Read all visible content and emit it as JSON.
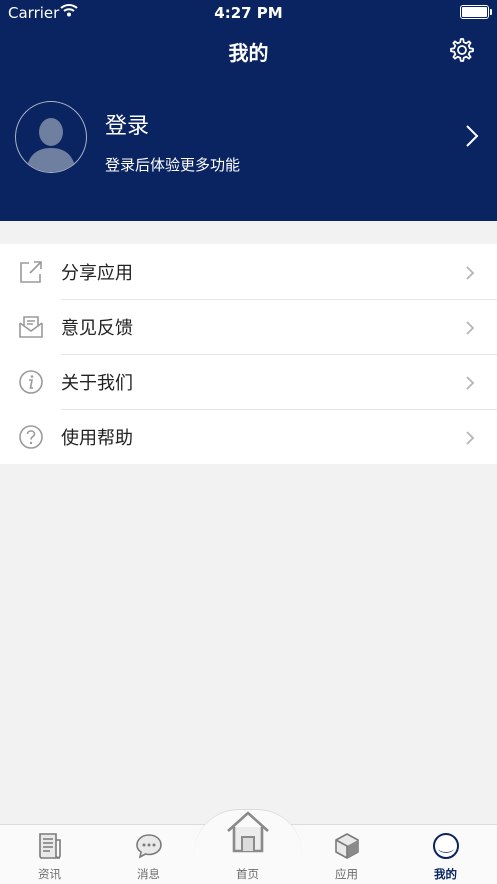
{
  "status_bar": {
    "carrier": "Carrier",
    "time": "4:27 PM"
  },
  "nav": {
    "title": "我的",
    "settings_icon": "gear-icon"
  },
  "profile": {
    "login_label": "登录",
    "login_hint": "登录后体验更多功能",
    "avatar_icon": "default-avatar-icon"
  },
  "menu": {
    "items": [
      {
        "label": "分享应用",
        "icon": "share-icon"
      },
      {
        "label": "意见反馈",
        "icon": "feedback-mail-icon"
      },
      {
        "label": "关于我们",
        "icon": "info-icon"
      },
      {
        "label": "使用帮助",
        "icon": "help-icon"
      }
    ]
  },
  "tabbar": {
    "active": "我的",
    "tabs": [
      {
        "label": "资讯",
        "icon": "news-icon"
      },
      {
        "label": "消息",
        "icon": "message-icon"
      },
      {
        "label": "首页",
        "icon": "home-icon"
      },
      {
        "label": "应用",
        "icon": "apps-cube-icon"
      },
      {
        "label": "我的",
        "icon": "profile-icon"
      }
    ]
  },
  "colors": {
    "header_bg": "#0a2462",
    "page_bg": "#f2f2f2",
    "accent": "#0a2462"
  }
}
